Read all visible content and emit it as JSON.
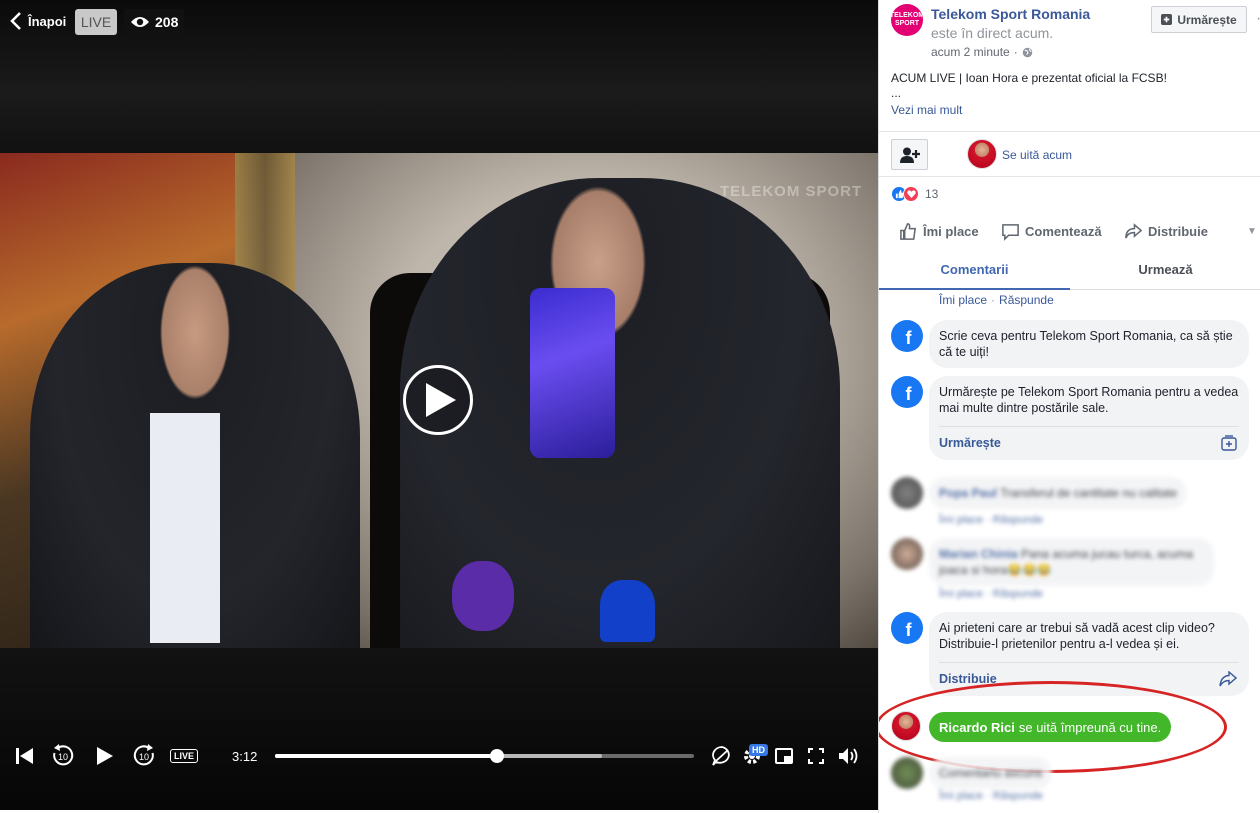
{
  "video": {
    "back_label": "Înapoi",
    "live_badge": "LIVE",
    "viewer_count": "208",
    "watermark": "TELEKOM SPORT",
    "controls": {
      "current_time": "3:12",
      "live_label": "LIVE",
      "hd_label": "HD",
      "progress_fraction": 0.53,
      "buffered_fraction": 0.78,
      "rewind_seconds": "10",
      "forward_seconds": "10"
    }
  },
  "post": {
    "page_avatar_line1": "TELEKOM",
    "page_avatar_line2": "SPORT",
    "page_name": "Telekom Sport Romania",
    "status": "este în direct acum.",
    "timestamp": "acum 2 minute",
    "follow_label": "Urmărește",
    "more_label": "···",
    "text": "ACUM LIVE | Ioan Hora e prezentat oficial la FCSB!",
    "ellipsis": "...",
    "see_more": "Vezi mai mult",
    "watching_now": "Se uită acum",
    "reaction_count": "13",
    "actions": {
      "like": "Îmi place",
      "comment": "Comentează",
      "share": "Distribuie"
    },
    "tabs": {
      "comments": "Comentarii",
      "follow": "Urmează"
    }
  },
  "comments": {
    "top_meta_like": "Îmi place",
    "top_meta_reply": "Răspunde",
    "prompt_write": "Scrie ceva pentru Telekom Sport Romania, ca să știe că te uiți!",
    "prompt_follow": "Urmărește pe Telekom Sport Romania pentru a vedea mai multe dintre postările sale.",
    "prompt_follow_link": "Urmărește",
    "blurred1_name": "Popa Paul",
    "blurred1_text": "Transferul de cantitate nu calitate",
    "blurred1_meta": "Îmi place · Răspunde",
    "blurred2_name": "Marian Chinia",
    "blurred2_text": "Pana acuma jucau turca, acuma joaca si hora😂😂😂",
    "blurred2_meta": "Îmi place · Răspunde",
    "prompt_share": "Ai prieteni care ar trebui să vadă acest clip video? Distribuie-l prietenilor pentru a-l vedea și ei.",
    "prompt_share_link": "Distribuie",
    "watch_party_name": "Ricardo Rici",
    "watch_party_text": "se uită împreună cu tine.",
    "blurred3_text": "Comentariu ascuns",
    "blurred3_meta": "Îmi place · Răspunde"
  },
  "colors": {
    "facebook_blue": "#1877f2",
    "link_blue": "#385898",
    "green_pill": "#42b72a",
    "annotation_red": "#d62424"
  },
  "icons": [
    "chevron-left-icon",
    "eye-icon",
    "play-icon",
    "skip-back-icon",
    "rewind-10-icon",
    "forward-10-icon",
    "no-comment-icon",
    "gear-icon",
    "miniplayer-icon",
    "fullscreen-icon",
    "volume-icon",
    "globe-icon",
    "add-friend-icon",
    "like-icon",
    "comment-icon",
    "share-icon",
    "plus-box-icon",
    "share-arrow-icon",
    "facebook-icon"
  ]
}
